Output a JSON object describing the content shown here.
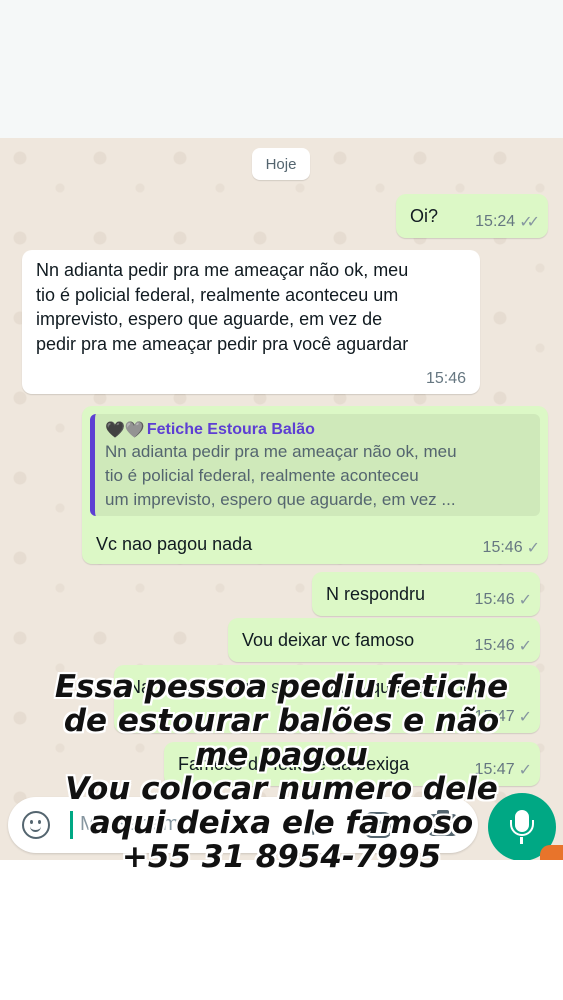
{
  "date_chip": "Hoje",
  "messages": [
    {
      "text": "Oi?",
      "time": "15:24",
      "ticks": "✓✓"
    },
    {
      "lines": [
        "Nn adianta pedir pra me ameaçar não ok, meu",
        "tio é policial federal, realmente aconteceu um",
        "imprevisto, espero que aguarde, em vez de",
        "pedir pra me ameaçar pedir pra você aguardar"
      ],
      "time": "15:46"
    },
    {
      "quote": {
        "hearts": "🖤🩶",
        "author": "Fetiche Estoura Balão",
        "lines": [
          "Nn adianta pedir pra me ameaçar não ok, meu",
          "tio é policial federal, realmente aconteceu",
          "um imprevisto, espero que aguarde, em vez ..."
        ]
      },
      "text": "Vc nao pagou nada",
      "time": "15:46",
      "ticks": "✓"
    },
    {
      "text": "N respondru",
      "time": "15:46",
      "ticks": "✓"
    },
    {
      "text": "Vou deixar vc famoso",
      "time": "15:46",
      "ticks": "✓"
    },
    {
      "text": "Nao o ameacar e sim pagar o que combinou",
      "time": "15:47",
      "ticks": "✓"
    },
    {
      "text": "Famoso do fetiche da bexiga",
      "time": "15:47",
      "ticks": "✓"
    }
  ],
  "input": {
    "placeholder": "Mensagem",
    "rs_label": "R$"
  },
  "overlay_lines": [
    "Essa pessoa pediu fetiche",
    "de estourar balões e não",
    "me pagou",
    "Vou colocar numero dele",
    "aqui deixa ele famoso",
    "+55 31 8954-7995"
  ],
  "colors": {
    "outgoing": "#dcf8c6",
    "incoming": "#ffffff",
    "accent": "#00a884",
    "quote_bar": "#5d3fd3"
  }
}
